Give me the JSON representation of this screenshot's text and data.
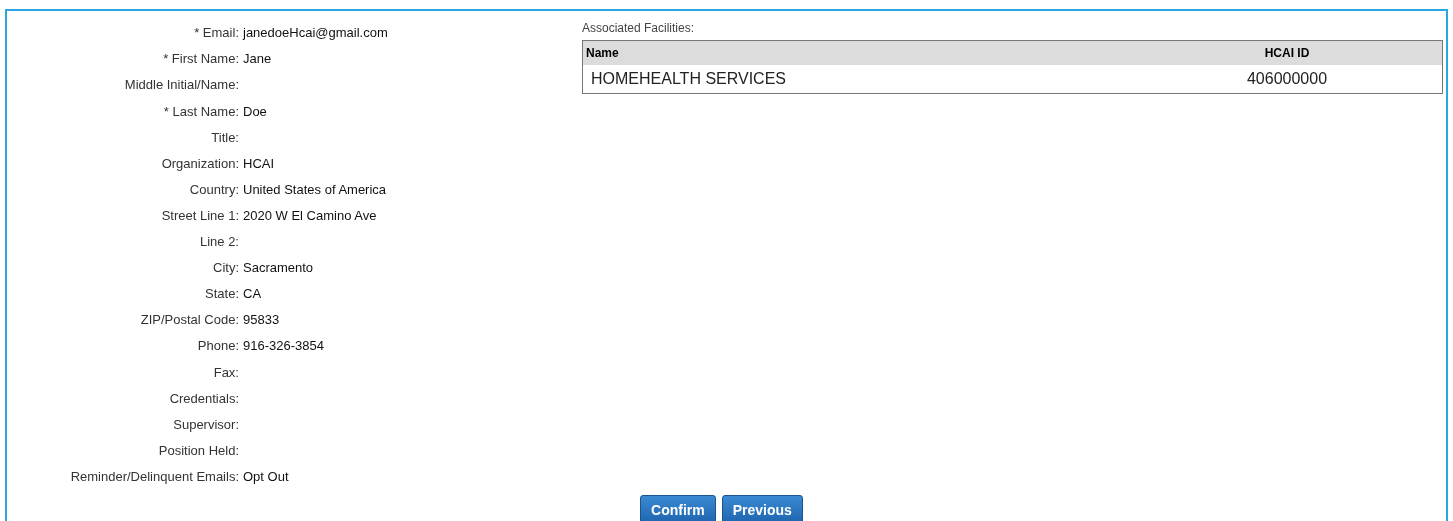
{
  "profile": [
    {
      "label": "* Email:",
      "value": "janedoeHcai@gmail.com"
    },
    {
      "label": "* First Name:",
      "value": "Jane"
    },
    {
      "label": "Middle Initial/Name:"
    },
    {
      "label": "* Last Name:",
      "value": "Doe"
    },
    {
      "label": "Title:"
    },
    {
      "label": "Organization:",
      "value": "HCAI"
    },
    {
      "label": "Country:",
      "value": "United States of America"
    },
    {
      "label": "Street Line 1:",
      "value": "2020 W El Camino Ave"
    },
    {
      "label": "Line 2:"
    },
    {
      "label": "City:",
      "value": "Sacramento"
    },
    {
      "label": "State:",
      "value": "CA"
    },
    {
      "label": "ZIP/Postal Code:",
      "value": "95833"
    },
    {
      "label": "Phone:",
      "value": "916-326-3854"
    },
    {
      "label": "Fax:"
    },
    {
      "label": "Credentials:"
    },
    {
      "label": "Supervisor:"
    },
    {
      "label": "Position Held:"
    },
    {
      "label": "Reminder/Delinquent Emails:",
      "value": "Opt Out"
    }
  ],
  "facilities": {
    "title": "Associated Facilities:",
    "columns": [
      "Name",
      "HCAI ID"
    ],
    "rows": [
      [
        "HOMEHEALTH SERVICES",
        "406000000"
      ]
    ]
  },
  "buttons": [
    "Confirm",
    "Previous"
  ]
}
